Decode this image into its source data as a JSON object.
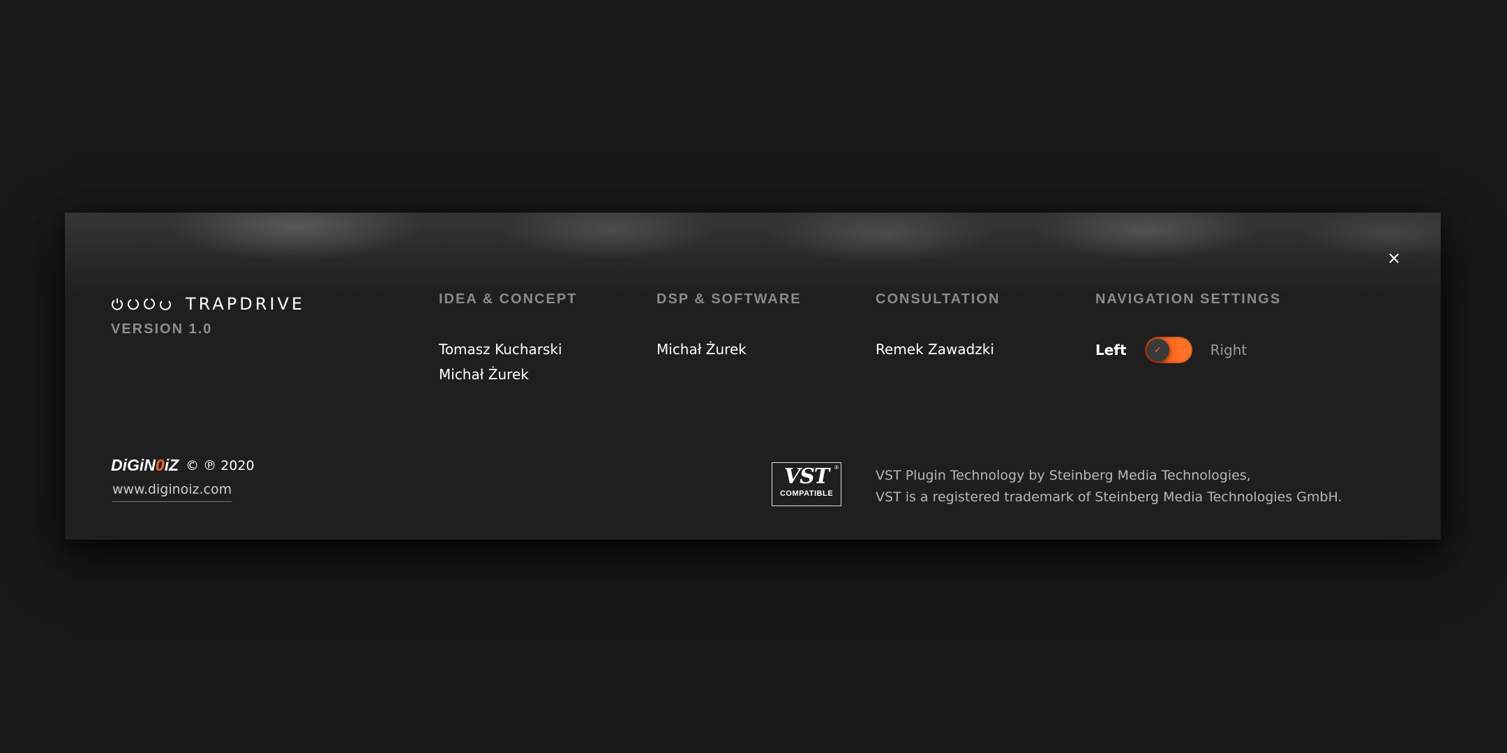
{
  "app": {
    "product_name": "TRAPDRIVE",
    "version": "VERSION 1.0"
  },
  "close_label": "×",
  "credits": [
    {
      "title": "IDEA & CONCEPT",
      "names": [
        "Tomasz Kucharski",
        "Michał Żurek"
      ]
    },
    {
      "title": "DSP & SOFTWARE",
      "names": [
        "Michał Żurek"
      ]
    },
    {
      "title": "CONSULTATION",
      "names": [
        "Remek Zawadzki"
      ]
    }
  ],
  "navigation": {
    "title": "NAVIGATION SETTINGS",
    "left_label": "Left",
    "right_label": "Right",
    "toggle_icon": "✓",
    "selected": "Left"
  },
  "footer": {
    "brand_main": "DiGiN",
    "brand_flame": "0",
    "brand_end": "iZ",
    "copyright": "© ℗ 2020",
    "website": "www.diginoiz.com"
  },
  "vst": {
    "badge_big": "VST",
    "badge_small": "COMPATIBLE",
    "badge_reg": "®",
    "line1": "VST Plugin Technology by Steinberg Media Technologies,",
    "line2": "VST is a registered trademark of Steinberg Media Technologies GmbH."
  },
  "colors": {
    "accent": "#ff6a20",
    "background": "#191919",
    "panel": "#1f1f1f"
  }
}
